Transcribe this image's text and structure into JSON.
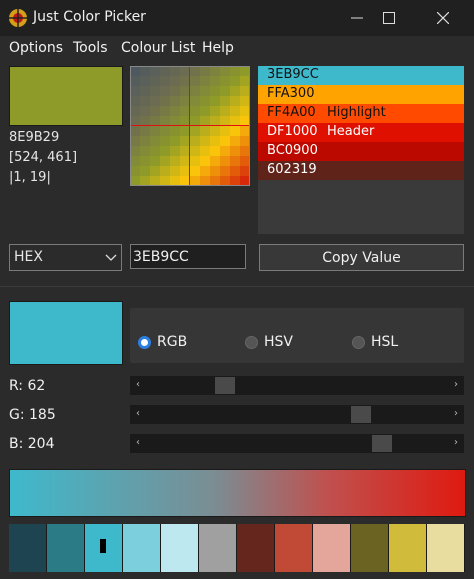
{
  "window": {
    "title": "Just Color Picker"
  },
  "menu": [
    "Options",
    "Tools",
    "Colour List",
    "Help"
  ],
  "picked": {
    "hex": "8E9B29",
    "coords": "[524, 461]",
    "offset": "|1, 19|",
    "color": "#8e9b29"
  },
  "colour_list": [
    {
      "hex": "3EB9CC",
      "name": "",
      "bg": "#3eb9cc",
      "fg": "#111111"
    },
    {
      "hex": "FFA300",
      "name": "",
      "bg": "#ffa300",
      "fg": "#111111"
    },
    {
      "hex": "FF4A00",
      "name": "Highlight",
      "bg": "#ff4a00",
      "fg": "#111111"
    },
    {
      "hex": "DF1000",
      "name": "Header",
      "bg": "#df1000",
      "fg": "#ffffff"
    },
    {
      "hex": "BC0900",
      "name": "",
      "bg": "#bc0900",
      "fg": "#ffffff"
    },
    {
      "hex": "602319",
      "name": "",
      "bg": "#602319",
      "fg": "#ffffff"
    }
  ],
  "format": {
    "selected": "HEX"
  },
  "value": "3EB9CC",
  "copy_label": "Copy Value",
  "current_color": "#3eb9cc",
  "modes": {
    "rgb": "RGB",
    "hsv": "HSV",
    "hsl": "HSL",
    "selected": "RGB"
  },
  "sliders": [
    {
      "label": "R: 62",
      "value": 62,
      "max": 255
    },
    {
      "label": "G: 185",
      "value": 185,
      "max": 255
    },
    {
      "label": "B: 204",
      "value": 204,
      "max": 255
    }
  ],
  "palette": [
    "#1d4450",
    "#2b7b86",
    "#3eb9cc",
    "#7ccfdc",
    "#bde8ef",
    "#a0a0a0",
    "#65261d",
    "#c04a36",
    "#e4a59b",
    "#6b6322",
    "#d0bb3b",
    "#e8dc9e"
  ],
  "palette_selected_index": 2
}
